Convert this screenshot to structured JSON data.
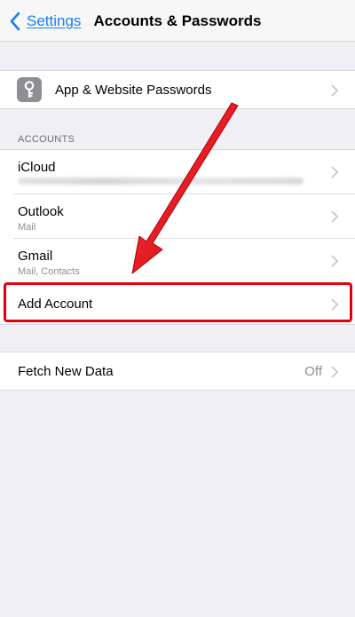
{
  "nav": {
    "back_label": "Settings",
    "title": "Accounts & Passwords"
  },
  "passwords": {
    "label": "App & Website Passwords"
  },
  "accounts_section": {
    "header": "ACCOUNTS",
    "items": [
      {
        "name": "iCloud",
        "detail": ""
      },
      {
        "name": "Outlook",
        "detail": "Mail"
      },
      {
        "name": "Gmail",
        "detail": "Mail, Contacts"
      }
    ],
    "add_account": "Add Account"
  },
  "fetch": {
    "label": "Fetch New Data",
    "value": "Off"
  },
  "annotation": {
    "color": "#e3000f"
  },
  "colors": {
    "link": "#1a7cf6",
    "background": "#efeff4"
  }
}
